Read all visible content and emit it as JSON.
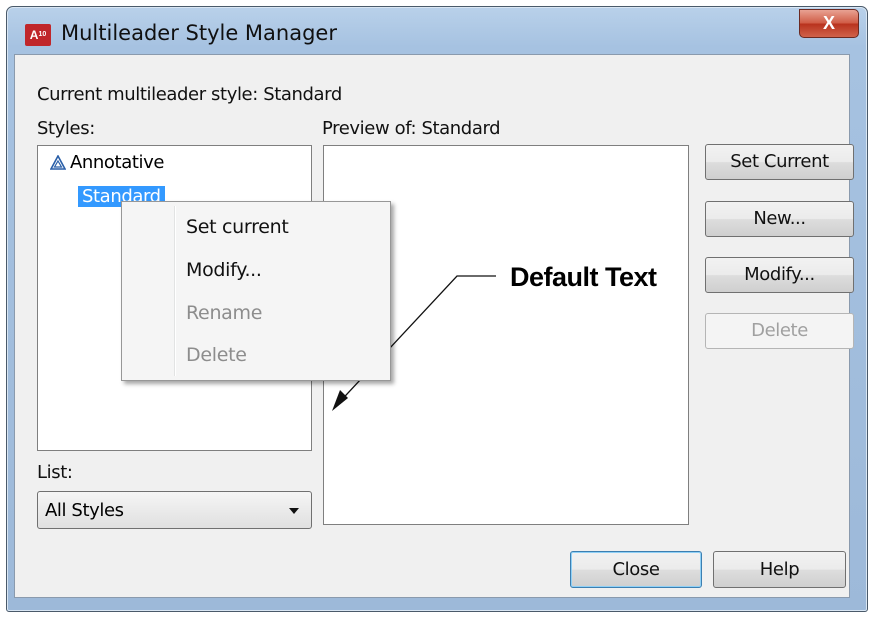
{
  "window": {
    "title": "Multileader Style Manager",
    "icon": "A10",
    "close_glyph": "X"
  },
  "current_style": {
    "label": "Current multileader style: Standard"
  },
  "styles": {
    "label": "Styles:",
    "items": [
      {
        "label": "Annotative",
        "icon": "annotative-icon"
      },
      {
        "label": "Standard",
        "selected": true
      }
    ]
  },
  "preview": {
    "label": "Preview of: Standard",
    "sample_text": "Default Text"
  },
  "list": {
    "label": "List:",
    "value": "All Styles"
  },
  "buttons": {
    "set_current": "Set Current",
    "new": "New...",
    "modify": "Modify...",
    "delete": "Delete",
    "close": "Close",
    "help": "Help"
  },
  "context_menu": {
    "items": [
      {
        "label": "Set current",
        "enabled": true
      },
      {
        "label": "Modify...",
        "enabled": true
      },
      {
        "label": "Rename",
        "enabled": false
      },
      {
        "label": "Delete",
        "enabled": false
      }
    ]
  },
  "colors": {
    "selection": "#3399ff",
    "close_button": "#c9452c",
    "title_bar": "#b9d1ea"
  }
}
